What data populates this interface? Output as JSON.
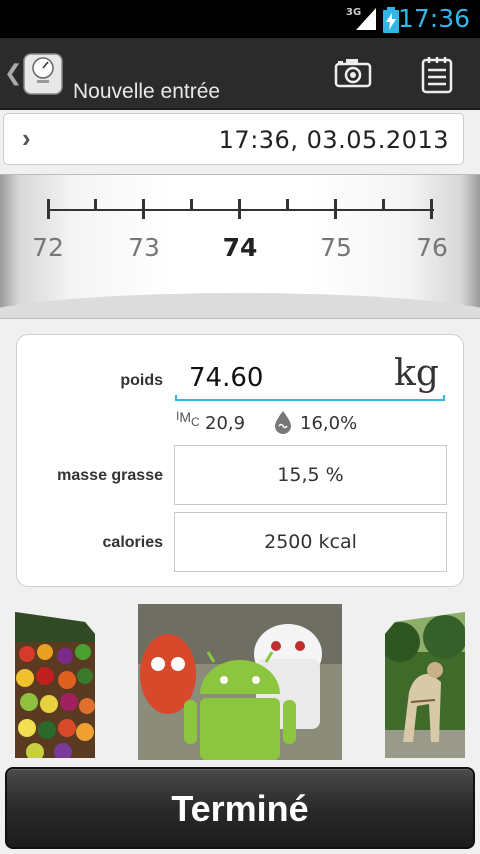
{
  "status_bar": {
    "network": "3G",
    "time": "17:36"
  },
  "action_bar": {
    "back_icon": "chevron-left-icon",
    "app_icon": "scale-icon",
    "title": "Nouvelle entrée",
    "camera_icon": "camera-icon",
    "notes_icon": "notepad-icon"
  },
  "date_row": {
    "datetime": "17:36,  03.05.2013"
  },
  "ruler": {
    "labels": [
      "72",
      "73",
      "74",
      "75",
      "76"
    ],
    "selected": "74"
  },
  "form": {
    "weight_label": "poids",
    "weight_value": "74.60",
    "weight_unit": "kg",
    "imc_label": "IMC",
    "imc_value": "20,9",
    "water_value": "16,0%",
    "fat_label": "masse grasse",
    "fat_value": "15,5 %",
    "calories_label": "calories",
    "calories_value": "2500 kcal"
  },
  "gallery": {
    "items": [
      "fruit-market-photo",
      "android-figures-photo",
      "sculpture-park-photo"
    ]
  },
  "done_button": {
    "label": "Terminé"
  },
  "colors": {
    "accent": "#33b5e5",
    "action_bar": "#2b2b2b"
  }
}
